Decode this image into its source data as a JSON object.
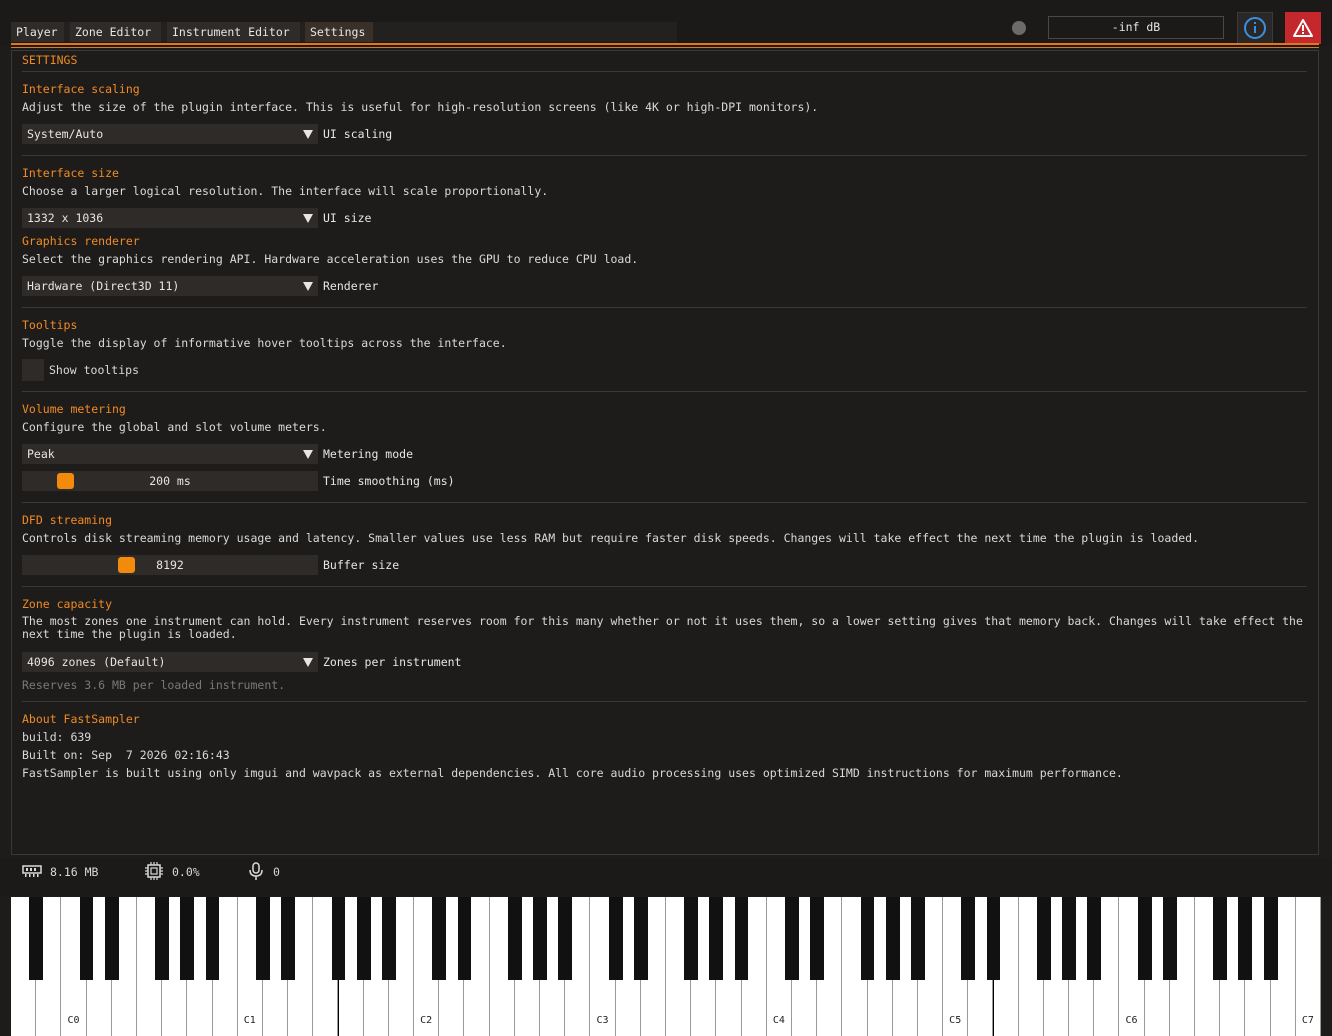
{
  "tabs": [
    {
      "label": "Player"
    },
    {
      "label": "Zone Editor"
    },
    {
      "label": "Instrument Editor"
    },
    {
      "label": "Settings"
    }
  ],
  "header": {
    "level_readout": "-inf dB",
    "info_icon": "info-icon",
    "warning_icon": "warning-icon",
    "info_color": "#3b8fe0",
    "warning_bg": "#c4282d"
  },
  "settings": {
    "title": "SETTINGS",
    "interface_scaling": {
      "heading": "Interface scaling",
      "desc": "Adjust the size of the plugin interface. This is useful for high-resolution screens (like 4K or high-DPI monitors).",
      "value": "System/Auto",
      "label": "UI scaling"
    },
    "interface_size": {
      "heading": "Interface size",
      "desc": "Choose a larger logical resolution. The interface will scale proportionally.",
      "value": "1332 x 1036",
      "label": "UI size"
    },
    "graphics_renderer": {
      "heading": "Graphics renderer",
      "desc": "Select the graphics rendering API. Hardware acceleration uses the GPU to reduce CPU load.",
      "value": "Hardware (Direct3D 11)",
      "label": "Renderer"
    },
    "tooltips": {
      "heading": "Tooltips",
      "desc": "Toggle the display of informative hover tooltips across the interface.",
      "label": "Show tooltips",
      "checked": false
    },
    "volume_metering": {
      "heading": "Volume metering",
      "desc": "Configure the global and slot volume meters.",
      "mode_value": "Peak",
      "mode_label": "Metering mode",
      "smoothing_value": "200 ms",
      "smoothing_label": "Time smoothing (ms)",
      "smoothing_fraction": 0.12
    },
    "dfd_streaming": {
      "heading": "DFD streaming",
      "desc": "Controls disk streaming memory usage and latency. Smaller values use less RAM but require faster disk speeds. Changes will take effect the next time the plugin is loaded.",
      "value": "8192",
      "label": "Buffer size",
      "fraction": 0.34
    },
    "zone_capacity": {
      "heading": "Zone capacity",
      "desc": "The most zones one instrument can hold. Every instrument reserves room for this many whether or not it uses them, so a lower setting gives that memory back. Changes will take effect the next time the plugin is loaded.",
      "value": "4096 zones (Default)",
      "label": "Zones per instrument",
      "note": "Reserves 3.6 MB per loaded instrument."
    },
    "about": {
      "heading": "About FastSampler",
      "build": "build: 639",
      "built_on": "Built on: Sep  7 2026 02:16:43",
      "info": "FastSampler is built using only imgui and wavpack as external dependencies. All core audio processing uses optimized SIMD instructions for maximum performance."
    }
  },
  "status": {
    "memory": "8.16 MB",
    "memory_icon": "memory-icon",
    "cpu": "0.0%",
    "cpu_icon": "cpu-icon",
    "voices": "0",
    "voices_icon": "microphone-icon"
  },
  "keyboard": {
    "octave_labels": [
      "C0",
      "C1",
      "C2",
      "C3",
      "C4",
      "C5",
      "C6",
      "C7"
    ]
  }
}
